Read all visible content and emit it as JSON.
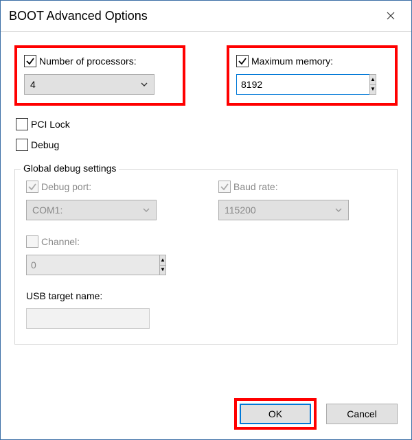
{
  "window": {
    "title": "BOOT Advanced Options"
  },
  "processors": {
    "label": "Number of processors:",
    "checked": true,
    "value": "4"
  },
  "memory": {
    "label": "Maximum memory:",
    "checked": true,
    "value": "8192"
  },
  "pci_lock": {
    "label": "PCI Lock",
    "checked": false
  },
  "debug": {
    "label": "Debug",
    "checked": false
  },
  "global_debug": {
    "legend": "Global debug settings",
    "debug_port": {
      "label": "Debug port:",
      "value": "COM1:"
    },
    "baud_rate": {
      "label": "Baud rate:",
      "value": "115200"
    },
    "channel": {
      "label": "Channel:",
      "value": "0"
    },
    "usb_target": {
      "label": "USB target name:",
      "value": ""
    }
  },
  "buttons": {
    "ok": "OK",
    "cancel": "Cancel"
  }
}
